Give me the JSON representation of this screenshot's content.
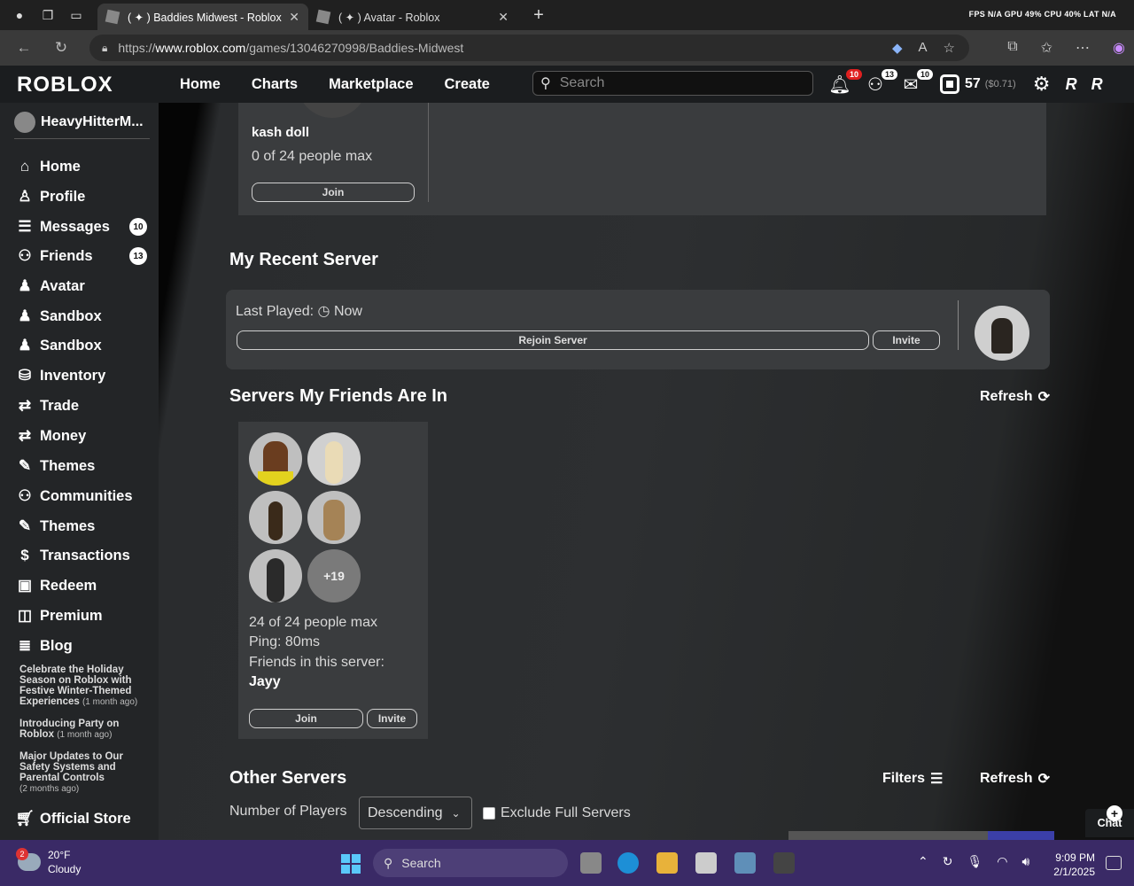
{
  "browser": {
    "tabs": [
      {
        "title": "( ✦ ) Baddies Midwest - Roblox",
        "active": true
      },
      {
        "title": "( ✦ ) Avatar - Roblox",
        "active": false
      }
    ],
    "perf_overlay": "FPS N/A GPU 49% CPU 40% LAT N/A",
    "url_prefix": "https://",
    "url_domain": "www.roblox.com",
    "url_path": "/games/13046270998/Baddies-Midwest"
  },
  "header": {
    "logo": "ROBLOX",
    "nav": [
      "Home",
      "Charts",
      "Marketplace",
      "Create"
    ],
    "search_placeholder": "Search",
    "notifications_count": "10",
    "friends_count": "13",
    "messages_count": "10",
    "robux": "57",
    "robux_usd": "($0.71)"
  },
  "sidebar": {
    "username": "HeavyHitterM...",
    "items": [
      {
        "label": "Home",
        "icon": "⌂"
      },
      {
        "label": "Profile",
        "icon": "♙"
      },
      {
        "label": "Messages",
        "icon": "☰",
        "badge": "10"
      },
      {
        "label": "Friends",
        "icon": "⚇",
        "badge": "13"
      },
      {
        "label": "Avatar",
        "icon": "♟"
      },
      {
        "label": "Sandbox",
        "icon": "♟"
      },
      {
        "label": "Sandbox",
        "icon": "♟"
      },
      {
        "label": "Inventory",
        "icon": "⛁"
      },
      {
        "label": "Trade",
        "icon": "⇄"
      },
      {
        "label": "Money",
        "icon": "⇄"
      },
      {
        "label": "Themes",
        "icon": "✎"
      },
      {
        "label": "Communities",
        "icon": "⚇"
      },
      {
        "label": "Themes",
        "icon": "✎"
      },
      {
        "label": "Transactions",
        "icon": "$"
      },
      {
        "label": "Redeem",
        "icon": "▣"
      },
      {
        "label": "Premium",
        "icon": "◫"
      },
      {
        "label": "Blog",
        "icon": "≣"
      }
    ],
    "blog_posts": [
      {
        "title": "Celebrate the Holiday Season on Roblox with Festive Winter-Themed Experiences",
        "age": "(1 month ago)"
      },
      {
        "title": "Introducing Party on Roblox",
        "age": "(1 month ago)"
      },
      {
        "title": "Major Updates to Our Safety Systems and Parental Controls",
        "age": "(2 months ago)"
      }
    ],
    "official_store": "Official Store"
  },
  "top_server": {
    "name": "kash doll",
    "capacity": "0 of 24 people max",
    "join_label": "Join"
  },
  "recent_server": {
    "title": "My Recent Server",
    "last_played_label": "Last Played:",
    "last_played_value": "Now",
    "rejoin_label": "Rejoin Server",
    "invite_label": "Invite"
  },
  "friends_servers": {
    "title": "Servers My Friends Are In",
    "refresh_label": "Refresh",
    "more_count": "+19",
    "capacity": "24 of 24 people max",
    "ping": "Ping: 80ms",
    "friends_label": "Friends in this server:",
    "friend_name": "Jayy",
    "join_label": "Join",
    "invite_label": "Invite"
  },
  "other_servers": {
    "title": "Other Servers",
    "filters_label": "Filters",
    "refresh_label": "Refresh",
    "sort_label": "Number of Players",
    "sort_value": "Descending",
    "exclude_label": "Exclude Full Servers"
  },
  "chat": {
    "label": "Chat"
  },
  "taskbar": {
    "weather_badge": "2",
    "temperature": "20°F",
    "condition": "Cloudy",
    "search_label": "Search",
    "time": "9:09 PM",
    "date": "2/1/2025"
  }
}
